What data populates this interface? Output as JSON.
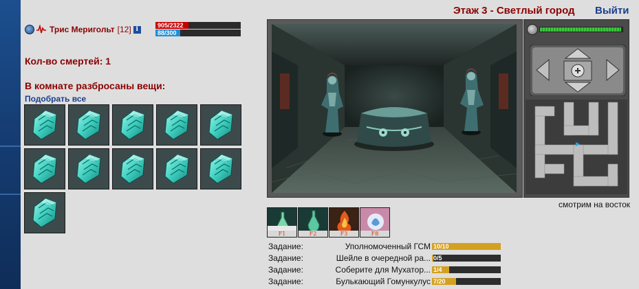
{
  "player": {
    "name": "Трис Меригольт",
    "level": "[12]",
    "hp_text": "905/2322",
    "hp_fraction": 0.39,
    "mp_text": "88/300",
    "mp_fraction": 0.29,
    "icons": [
      "clan-emblem-icon",
      "pulse-icon",
      "info-icon"
    ]
  },
  "deaths": "Кол-во смертей: 1",
  "items": {
    "title": "В комнате разбросаны вещи:",
    "pick_all": "Подобрать все",
    "slots": [
      "crystal-shard",
      "crystal-shard",
      "crystal-shard",
      "crystal-shard",
      "crystal-shard",
      "crystal-shard",
      "crystal-shard",
      "crystal-shard",
      "crystal-shard",
      "crystal-shard",
      "crystal-shard"
    ]
  },
  "header": {
    "location": "Этаж 3 - Светлый город",
    "exit": "Выйти"
  },
  "minimap": {
    "hp_fraction": 0.98,
    "facing": "смотрим на восток"
  },
  "hotkeys": [
    {
      "key": "F1",
      "icon": "potion-green-icon"
    },
    {
      "key": "F2",
      "icon": "potion-teal-icon"
    },
    {
      "key": "F3",
      "icon": "fire-scroll-icon"
    },
    {
      "key": "F8",
      "icon": "spirit-orb-icon"
    }
  ],
  "quests": [
    {
      "label": "Задание:",
      "name": "Уполномоченный ГСМ",
      "progress": "10/10",
      "fraction": 1.0
    },
    {
      "label": "Задание:",
      "name": "Шейле в очередной ра...",
      "progress": "0/5",
      "fraction": 0.0
    },
    {
      "label": "Задание:",
      "name": "Соберите для Мухатор...",
      "progress": "1/4",
      "fraction": 0.25
    },
    {
      "label": "Задание:",
      "name": "Булькающий Гомункулус",
      "progress": "7/20",
      "fraction": 0.35
    }
  ],
  "colors": {
    "title_red": "#8b0000",
    "link_blue": "#1a3f8f",
    "hp_red": "#c80000",
    "mp_blue": "#1f8fd8",
    "quest_gold": "#d4a020"
  }
}
